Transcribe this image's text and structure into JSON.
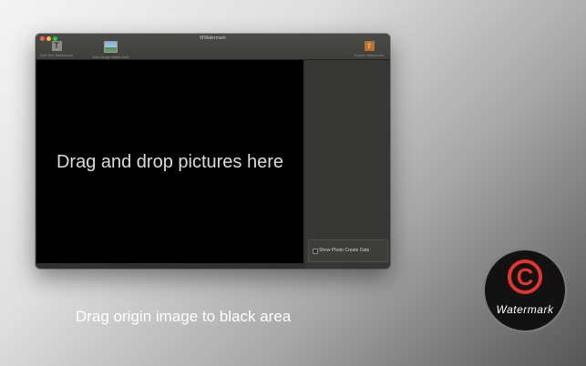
{
  "window": {
    "title": "MWatermark"
  },
  "toolbar": {
    "text_watermark_label": "Add Text Watermark",
    "text_watermark_icon": "T",
    "image_watermark_label": "Add Image Watermark",
    "export_label": "Export Watermark",
    "export_icon": "⇪"
  },
  "canvas": {
    "drop_text": "Drag and drop pictures here"
  },
  "sidepanel": {
    "show_date_label": "Show Photo Create Date",
    "show_date_checked": false
  },
  "caption": "Drag origin image to black area",
  "logo": {
    "symbol": "C",
    "text": "Watermark",
    "accent": "#e3352b"
  }
}
